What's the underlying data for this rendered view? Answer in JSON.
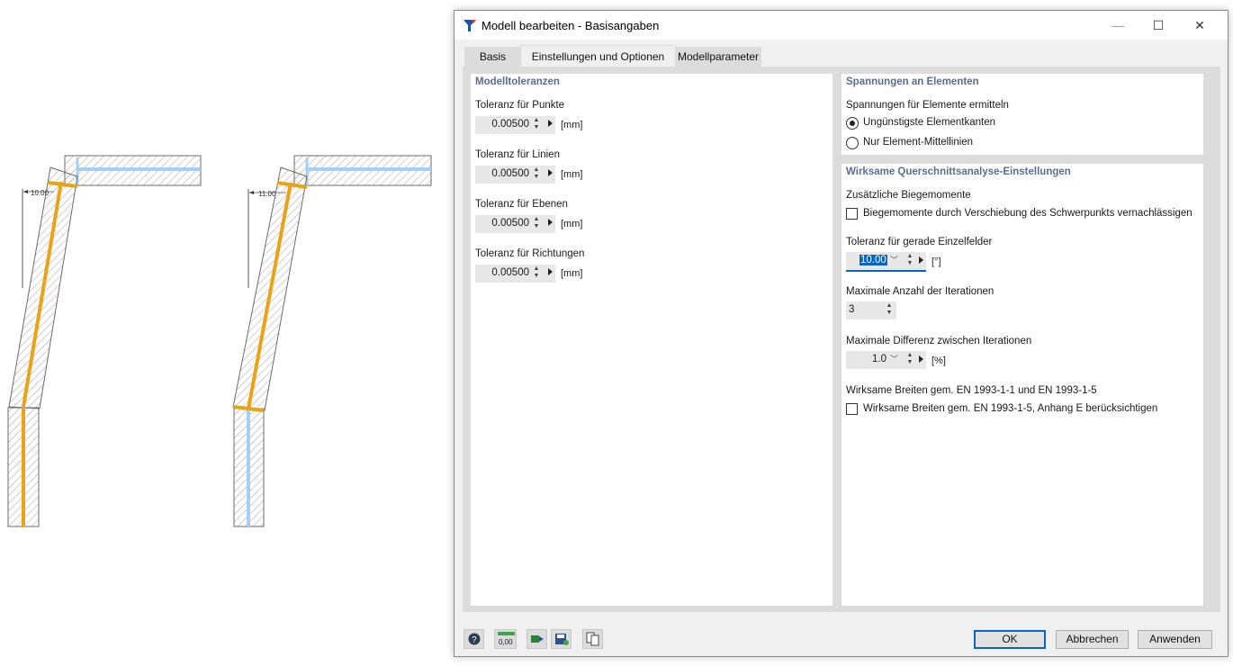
{
  "drawing": {
    "dim_left": "10.00",
    "dim_right": "11.00",
    "colors": {
      "member": "#e8a317",
      "section_line": "#a8cff0",
      "outline": "#6b6b6b"
    }
  },
  "dialog": {
    "title": "Modell bearbeiten - Basisangaben",
    "window_buttons": {
      "minimize": "—",
      "maximize": "☐",
      "close": "✕"
    },
    "tabs": [
      {
        "label": "Basis",
        "active": false
      },
      {
        "label": "Einstellungen und Optionen",
        "active": true
      },
      {
        "label": "Modellparameter",
        "active": false
      }
    ],
    "modelltoleranzen": {
      "title": "Modelltoleranzen",
      "fields": [
        {
          "label": "Toleranz für Punkte",
          "value": "0.00500",
          "unit": "[mm]"
        },
        {
          "label": "Toleranz für Linien",
          "value": "0.00500",
          "unit": "[mm]"
        },
        {
          "label": "Toleranz für Ebenen",
          "value": "0.00500",
          "unit": "[mm]"
        },
        {
          "label": "Toleranz für Richtungen",
          "value": "0.00500",
          "unit": "[mm]"
        }
      ]
    },
    "spannungen": {
      "title": "Spannungen an Elementen",
      "subtitle": "Spannungen für Elemente ermitteln",
      "options": [
        {
          "label": "Ungünstigste Elementkanten",
          "selected": true
        },
        {
          "label": "Nur Element-Mittellinien",
          "selected": false
        }
      ]
    },
    "wirksame": {
      "title": "Wirksame Querschnittsanalyse-Einstellungen",
      "biege_label": "Zusätzliche Biegemomente",
      "biege_check": "Biegemomente durch Verschiebung des Schwerpunkts vernachlässigen",
      "biege_checked": false,
      "toleranz_label": "Toleranz für gerade Einzelfelder",
      "toleranz_value": "10.00",
      "toleranz_unit": "[°]",
      "iter_label": "Maximale Anzahl der Iterationen",
      "iter_value": "3",
      "diff_label": "Maximale Differenz zwischen Iterationen",
      "diff_value": "1.0",
      "diff_unit": "[%]",
      "breiten_label": "Wirksame Breiten gem. EN 1993-1-1 und EN 1993-1-5",
      "breiten_check": "Wirksame Breiten gem. EN 1993-1-5, Anhang E berücksichtigen",
      "breiten_checked": false
    },
    "footer": {
      "tools": [
        "help-icon",
        "units-icon",
        "model-info-icon",
        "save-settings-icon",
        "copy-icon"
      ],
      "units_icon_text": "0,00",
      "ok": "OK",
      "cancel": "Abbrechen",
      "apply": "Anwenden"
    }
  }
}
